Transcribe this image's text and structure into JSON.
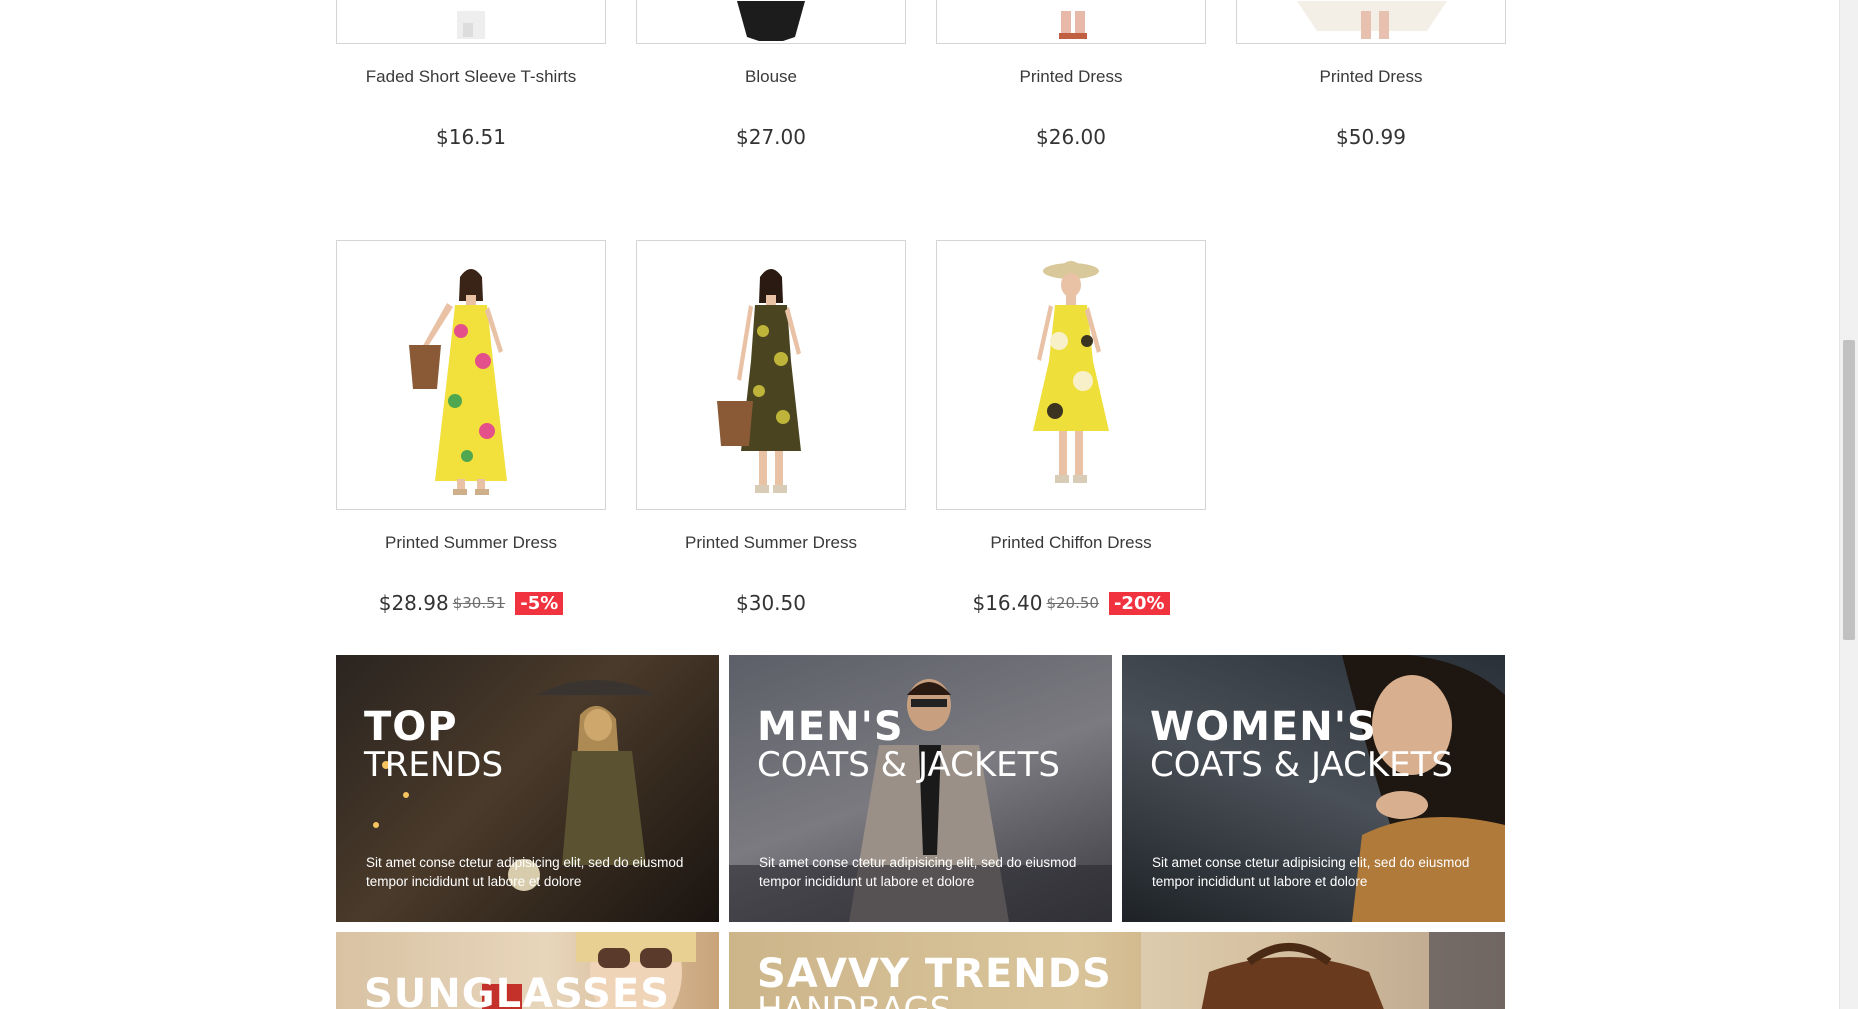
{
  "row1": [
    {
      "name": "Faded Short Sleeve T-shirts",
      "price": "$16.51"
    },
    {
      "name": "Blouse",
      "price": "$27.00"
    },
    {
      "name": "Printed Dress",
      "price": "$26.00"
    },
    {
      "name": "Printed Dress",
      "price": "$50.99"
    }
  ],
  "row2": [
    {
      "name": "Printed Summer Dress",
      "price": "$28.98",
      "old_price": "$30.51",
      "discount": "-5%"
    },
    {
      "name": "Printed Summer Dress",
      "price": "$30.50"
    },
    {
      "name": "Printed Chiffon Dress",
      "price": "$16.40",
      "old_price": "$20.50",
      "discount": "-20%"
    }
  ],
  "banners": [
    {
      "title": "TOP",
      "subtitle": "TRENDS",
      "text": "Sit amet conse ctetur adipisicing elit, sed do eiusmod tempor incididunt ut labore et dolore"
    },
    {
      "title": "MEN'S",
      "subtitle": "COATS & JACKETS",
      "text": "Sit amet conse ctetur adipisicing elit, sed do eiusmod tempor incididunt ut labore et dolore"
    },
    {
      "title": "WOMEN'S",
      "subtitle": "COATS & JACKETS",
      "text": "Sit amet conse ctetur adipisicing elit, sed do eiusmod tempor incididunt ut labore et dolore"
    },
    {
      "title": "SUNGLASSES"
    },
    {
      "title": "SAVVY TRENDS",
      "subtitle": "HANDBAGS"
    }
  ],
  "colors": {
    "discount_badge": "#f13340",
    "border": "#d6d4d4"
  }
}
